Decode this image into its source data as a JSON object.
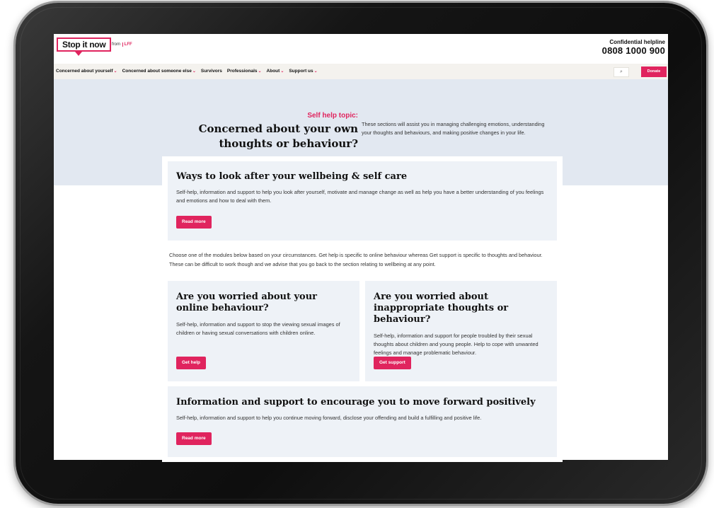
{
  "header": {
    "logo_text": "Stop it now",
    "from_prefix": "from",
    "from_brand": "LFF",
    "helpline_label": "Confidential helpline",
    "helpline_number": "0808 1000 900"
  },
  "nav": {
    "items": [
      {
        "label": "Concerned about yourself",
        "has_dropdown": true
      },
      {
        "label": "Concerned about someone else",
        "has_dropdown": true
      },
      {
        "label": "Survivors",
        "has_dropdown": false
      },
      {
        "label": "Professionals",
        "has_dropdown": true
      },
      {
        "label": "About",
        "has_dropdown": true
      },
      {
        "label": "Support us",
        "has_dropdown": true
      }
    ],
    "search_icon": "search-icon",
    "donate_label": "Donate"
  },
  "hero": {
    "kicker": "Self help topic:",
    "title": "Concerned about your own thoughts or behaviour?",
    "description": "These sections will assist you in managing challenging emotions, understanding your thoughts and behaviours, and making positive changes in your life."
  },
  "wellbeing": {
    "title": "Ways to look after your wellbeing & self care",
    "text": "Self-help, information and support to help you look after yourself, motivate and manage change as well as help you have a better understanding of you feelings and emotions and how to deal with them.",
    "button": "Read more"
  },
  "intro": "Choose one of the modules below based on your circumstances. Get help is specific to online behaviour whereas Get support is specific to thoughts and behaviour. These can be difficult to work though and we advise that you go back to the section relating to wellbeing at any point.",
  "online": {
    "title": "Are you worried about your online behaviour?",
    "text": "Self-help, information and support to stop the viewing sexual images of children or having sexual conversations with children online.",
    "button": "Get help"
  },
  "thoughts": {
    "title": "Are you worried about inappropriate thoughts or behaviour?",
    "text": "Self-help, information and support for people troubled by their sexual thoughts about children and young people. Help to cope with unwanted feelings and manage problematic behaviour.",
    "button": "Get support"
  },
  "forward": {
    "title": "Information and support to encourage you to move forward positively",
    "text": "Self-help, information and support to help you continue moving forward, disclose your offending and build a fulfilling and positive life.",
    "button": "Read more"
  },
  "colors": {
    "accent": "#e0245e",
    "hero_bg": "#e2e8f1",
    "card_bg": "#eef2f7",
    "nav_bg": "#f4f2ee"
  }
}
